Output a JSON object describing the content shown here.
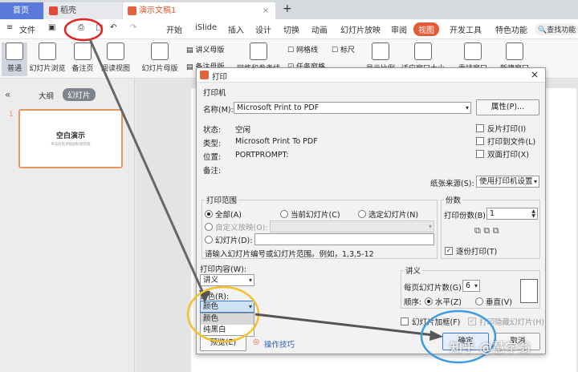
{
  "tabs": {
    "home": "首页",
    "doc": "稻壳",
    "ppt": "演示文稿1",
    "new_tab": "+"
  },
  "menu": {
    "file": "文件",
    "items": [
      "开始",
      "iSlide",
      "插入",
      "设计",
      "切换",
      "动画",
      "幻灯片放映",
      "审阅",
      "视图",
      "开发工具",
      "特色功能"
    ],
    "active": "视图",
    "search": "查找功能"
  },
  "ribbon": {
    "normal": "普通",
    "sorter": "幻灯片浏览",
    "notes": "备注页",
    "reading": "阅读视图",
    "slide_master": "幻灯片母版",
    "handout_master": "讲义母版",
    "notes_master": "备注母版",
    "gridlines": "网格线",
    "ruler": "标尺",
    "grid_guides": "网格和参考线",
    "taskpane": "任务窗格",
    "zoom_ratio": "显示比例",
    "fit_window": "适应窗口大小",
    "rearrange": "重排窗口",
    "new_window": "新建窗口"
  },
  "left_pane": {
    "outline_tab": "大纲",
    "slides_tab": "幻灯片",
    "slide_number": "1",
    "thumb_title": "空白演示",
    "thumb_sub": "单击此处添加副标题内容"
  },
  "dialog": {
    "title": "打印",
    "close": "×",
    "printer_section": "打印机",
    "name_label": "名称(M):",
    "name_value": "Microsoft Print to PDF",
    "properties_btn": "属性(P)...",
    "status_label": "状态:",
    "status_value": "空闲",
    "type_label": "类型:",
    "type_value": "Microsoft Print To PDF",
    "where_label": "位置:",
    "where_value": "PORTPROMPT:",
    "comment_label": "备注:",
    "reverse": "反片打印(I)",
    "to_file": "打印到文件(L)",
    "duplex": "双面打印(X)",
    "paper_source_label": "纸张来源(S):",
    "paper_source_value": "使用打印机设置",
    "range_section": "打印范围",
    "all": "全部(A)",
    "current": "当前幻灯片(C)",
    "selection": "选定幻灯片(N)",
    "custom_show": "自定义放映(O):",
    "slides": "幻灯片(D):",
    "range_hint": "请输入幻灯片编号或幻灯片范围。例如，1,3,5-12",
    "copies_section": "份数",
    "copies_label": "打印份数(B):",
    "copies_value": "1",
    "collate": "逐份打印(T)",
    "content_label": "打印内容(W):",
    "content_value": "讲义",
    "color_label": "颜色(R):",
    "color_value": "颜色",
    "color_options": [
      "颜色",
      "纯黑白"
    ],
    "handout_section": "讲义",
    "per_page_label": "每页幻灯片数(G):",
    "per_page_value": "6",
    "order_label": "顺序:",
    "horizontal": "水平(Z)",
    "vertical": "垂直(V)",
    "frame": "幻灯片加框(F)",
    "hidden": "打印隐藏幻灯片(H)",
    "preview_btn": "预览(E)",
    "tips": "操作技巧",
    "ok_btn": "确定",
    "cancel_btn": "取消"
  },
  "watermark": "知乎 @慧学翁",
  "colors": {
    "accent": "#e55a37",
    "annotation_red": "#e52020",
    "annotation_yellow": "#f5c12a",
    "annotation_blue": "#3d9be0"
  }
}
